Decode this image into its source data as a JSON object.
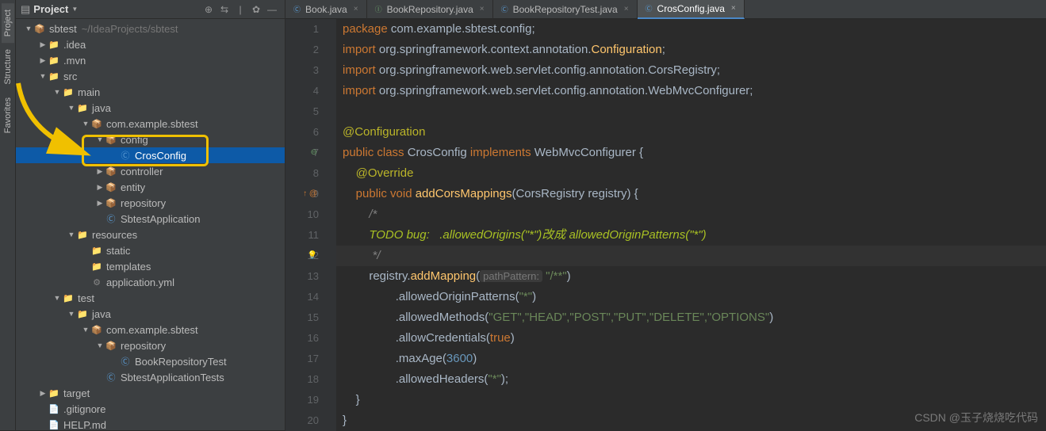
{
  "vtabs": [
    "Project",
    "Structure",
    "Favorites"
  ],
  "panel": {
    "title": "Project"
  },
  "tree": [
    {
      "d": 0,
      "a": "▼",
      "i": "📦",
      "ic": "folder blue",
      "t": "sbtest",
      "ext": "~/IdeaProjects/sbtest"
    },
    {
      "d": 1,
      "a": "▶",
      "i": "📁",
      "ic": "folder",
      "t": ".idea"
    },
    {
      "d": 1,
      "a": "▶",
      "i": "📁",
      "ic": "folder",
      "t": ".mvn"
    },
    {
      "d": 1,
      "a": "▼",
      "i": "📁",
      "ic": "folder blue",
      "t": "src"
    },
    {
      "d": 2,
      "a": "▼",
      "i": "📁",
      "ic": "folder",
      "t": "main"
    },
    {
      "d": 3,
      "a": "▼",
      "i": "📁",
      "ic": "folder blue",
      "t": "java"
    },
    {
      "d": 4,
      "a": "▼",
      "i": "📦",
      "ic": "pkg",
      "t": "com.example.sbtest"
    },
    {
      "d": 5,
      "a": "▼",
      "i": "📦",
      "ic": "pkg",
      "t": "config"
    },
    {
      "d": 6,
      "a": "",
      "i": "Ⓒ",
      "ic": "cls",
      "t": "CrosConfig",
      "sel": true
    },
    {
      "d": 5,
      "a": "▶",
      "i": "📦",
      "ic": "pkg",
      "t": "controller"
    },
    {
      "d": 5,
      "a": "▶",
      "i": "📦",
      "ic": "pkg",
      "t": "entity"
    },
    {
      "d": 5,
      "a": "▶",
      "i": "📦",
      "ic": "pkg",
      "t": "repository"
    },
    {
      "d": 5,
      "a": "",
      "i": "Ⓒ",
      "ic": "cls",
      "t": "SbtestApplication"
    },
    {
      "d": 3,
      "a": "▼",
      "i": "📁",
      "ic": "folder orange",
      "t": "resources"
    },
    {
      "d": 4,
      "a": "",
      "i": "📁",
      "ic": "folder",
      "t": "static"
    },
    {
      "d": 4,
      "a": "",
      "i": "📁",
      "ic": "folder",
      "t": "templates"
    },
    {
      "d": 4,
      "a": "",
      "i": "⚙",
      "ic": "yml",
      "t": "application.yml"
    },
    {
      "d": 2,
      "a": "▼",
      "i": "📁",
      "ic": "folder",
      "t": "test"
    },
    {
      "d": 3,
      "a": "▼",
      "i": "📁",
      "ic": "folder green",
      "t": "java"
    },
    {
      "d": 4,
      "a": "▼",
      "i": "📦",
      "ic": "pkg",
      "t": "com.example.sbtest"
    },
    {
      "d": 5,
      "a": "▼",
      "i": "📦",
      "ic": "pkg",
      "t": "repository"
    },
    {
      "d": 6,
      "a": "",
      "i": "Ⓒ",
      "ic": "cls",
      "t": "BookRepositoryTest"
    },
    {
      "d": 5,
      "a": "",
      "i": "Ⓒ",
      "ic": "cls",
      "t": "SbtestApplicationTests"
    },
    {
      "d": 1,
      "a": "▶",
      "i": "📁",
      "ic": "folder orange",
      "t": "target"
    },
    {
      "d": 1,
      "a": "",
      "i": "📄",
      "ic": "folder",
      "t": ".gitignore"
    },
    {
      "d": 1,
      "a": "",
      "i": "📄",
      "ic": "folder",
      "t": "HELP.md"
    }
  ],
  "tabs": [
    {
      "icon": "Ⓒ",
      "color": "#5a9bd4",
      "label": "Book.java"
    },
    {
      "icon": "Ⓘ",
      "color": "#6a9e6a",
      "label": "BookRepository.java"
    },
    {
      "icon": "Ⓒ",
      "color": "#5a9bd4",
      "label": "BookRepositoryTest.java"
    },
    {
      "icon": "Ⓒ",
      "color": "#5a9bd4",
      "label": "CrosConfig.java",
      "active": true
    }
  ],
  "code": {
    "l1": "package com.example.sbtest.config;",
    "l2": "import org.springframework.context.annotation.Configuration;",
    "l3": "import org.springframework.web.servlet.config.annotation.CorsRegistry;",
    "l4": "import org.springframework.web.servlet.config.annotation.WebMvcConfigurer;",
    "l6": "@Configuration",
    "l7a": "public class ",
    "l7b": "CrosConfig",
    "l7c": " implements ",
    "l7d": "WebMvcConfigurer {",
    "l8": "@Override",
    "l9a": "public void ",
    "l9b": "addCorsMappings",
    "l9c": "(CorsRegistry registry) {",
    "l10": "/*",
    "l11": "TODO bug:   .allowedOrigins(\"*\")改成 allowedOriginPatterns(\"*\")",
    "l12": " */",
    "l13a": "registry.",
    "l13b": "addMapping",
    "l13c": "(",
    "l13hint": "pathPattern:",
    "l13d": " \"/**\"",
    "l13e": ")",
    "l14a": ".allowedOriginPatterns(",
    "l14b": "\"*\"",
    "l14c": ")",
    "l15a": ".allowedMethods(",
    "l15b": "\"GET\"",
    "l15c": ",\"HEAD\",\"POST\",\"PUT\",\"DELETE\",\"OPTIONS\"",
    "l15d": ")",
    "l16a": ".allowCredentials(",
    "l16b": "true",
    "l16c": ")",
    "l17a": ".maxAge(",
    "l17b": "3600",
    "l17c": ")",
    "l18a": ".allowedHeaders(",
    "l18b": "\"*\"",
    "l18c": ");",
    "l19": "}",
    "l20": "}"
  },
  "watermark": "CSDN @玉子烧烧吃代码"
}
